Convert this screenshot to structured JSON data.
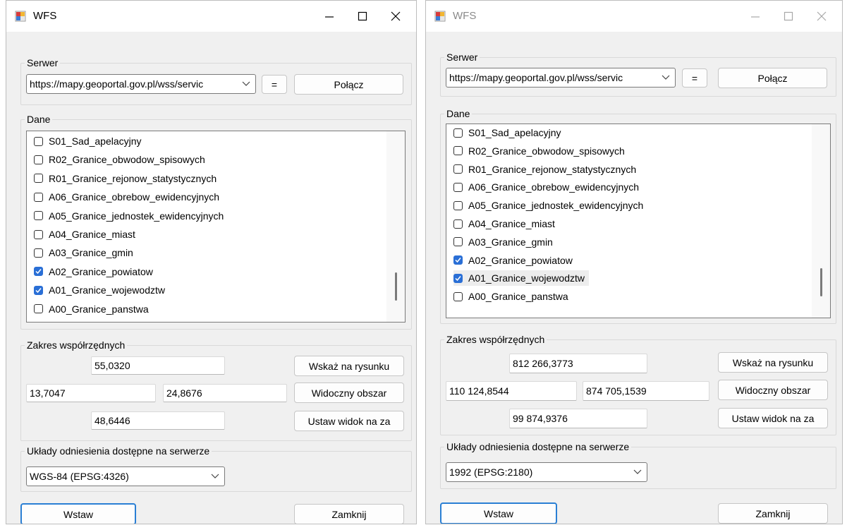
{
  "windows": [
    {
      "title": "WFS",
      "active": true,
      "server": {
        "group_label": "Serwer",
        "url": "https://mapy.geoportal.gov.pl/wss/servic",
        "equals_label": "=",
        "connect_label": "Połącz"
      },
      "data_group": {
        "label": "Dane",
        "items": [
          {
            "label": "S01_Sad_apelacyjny",
            "checked": false
          },
          {
            "label": "R02_Granice_obwodow_spisowych",
            "checked": false
          },
          {
            "label": "R01_Granice_rejonow_statystycznych",
            "checked": false
          },
          {
            "label": "A06_Granice_obrebow_ewidencyjnych",
            "checked": false
          },
          {
            "label": "A05_Granice_jednostek_ewidencyjnych",
            "checked": false
          },
          {
            "label": "A04_Granice_miast",
            "checked": false
          },
          {
            "label": "A03_Granice_gmin",
            "checked": false
          },
          {
            "label": "A02_Granice_powiatow",
            "checked": true
          },
          {
            "label": "A01_Granice_wojewodztw",
            "checked": true
          },
          {
            "label": "A00_Granice_panstwa",
            "checked": false
          }
        ]
      },
      "extent": {
        "group_label": "Zakres współrzędnych",
        "north": "55,0320",
        "west": "13,7047",
        "east": "24,8676",
        "south": "48,6446",
        "pick_label": "Wskaż na rysunku",
        "visible_label": "Widoczny obszar",
        "set_view_label": "Ustaw widok na za"
      },
      "crs": {
        "group_label": "Układy odniesienia dostępne na serwerze",
        "selected": "WGS-84 (EPSG:4326)"
      },
      "insert_label": "Wstaw",
      "close_label": "Zamknij"
    },
    {
      "title": "WFS",
      "active": false,
      "server": {
        "group_label": "Serwer",
        "url": "https://mapy.geoportal.gov.pl/wss/servic",
        "equals_label": "=",
        "connect_label": "Połącz"
      },
      "data_group": {
        "label": "Dane",
        "items": [
          {
            "label": "S01_Sad_apelacyjny",
            "checked": false
          },
          {
            "label": "R02_Granice_obwodow_spisowych",
            "checked": false
          },
          {
            "label": "R01_Granice_rejonow_statystycznych",
            "checked": false
          },
          {
            "label": "A06_Granice_obrebow_ewidencyjnych",
            "checked": false
          },
          {
            "label": "A05_Granice_jednostek_ewidencyjnych",
            "checked": false
          },
          {
            "label": "A04_Granice_miast",
            "checked": false
          },
          {
            "label": "A03_Granice_gmin",
            "checked": false
          },
          {
            "label": "A02_Granice_powiatow",
            "checked": true
          },
          {
            "label": "A01_Granice_wojewodztw",
            "checked": true
          },
          {
            "label": "A00_Granice_panstwa",
            "checked": false
          }
        ]
      },
      "extent": {
        "group_label": "Zakres współrzędnych",
        "north": "812 266,3773",
        "west": "110 124,8544",
        "east": "874 705,1539",
        "south": "99 874,9376",
        "pick_label": "Wskaż na rysunku",
        "visible_label": "Widoczny obszar",
        "set_view_label": "Ustaw widok na za"
      },
      "crs": {
        "group_label": "Układy odniesienia dostępne na serwerze",
        "selected": "1992 (EPSG:2180)"
      },
      "insert_label": "Wstaw",
      "close_label": "Zamknij"
    }
  ]
}
